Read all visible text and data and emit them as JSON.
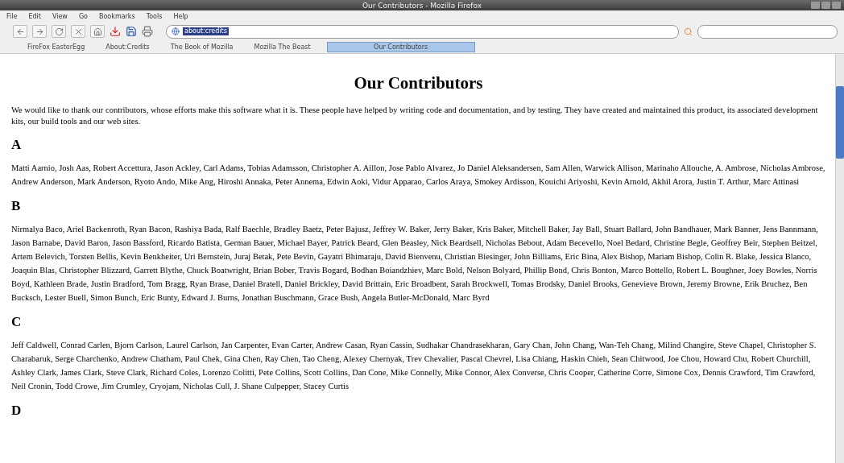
{
  "window": {
    "title": "Our Contributors - Mozilla Firefox"
  },
  "menu": [
    "File",
    "Edit",
    "View",
    "Go",
    "Bookmarks",
    "Tools",
    "Help"
  ],
  "address": {
    "value": "about:credits"
  },
  "bookmarks": [
    {
      "label": "FireFox EasterEgg",
      "selected": false
    },
    {
      "label": "About:Credits",
      "selected": false
    },
    {
      "label": "The Book of Mozilla",
      "selected": false
    },
    {
      "label": "Mozilla The Beast",
      "selected": false
    },
    {
      "label": "Our Contributors",
      "selected": true
    }
  ],
  "page": {
    "heading": "Our Contributors",
    "intro": "We would like to thank our contributors, whose efforts make this software what it is. These people have helped by writing code and documentation, and by testing. They have created and maintained this product, its associated development kits, our build tools and our web sites.",
    "sections": [
      {
        "letter": "A",
        "names": "Matti Aarnio, Josh Aas, Robert Accettura, Jason Ackley, Carl Adams, Tobias Adamsson, Christopher A. Aillon, Jose Pablo Alvarez, Jo Daniel Aleksandersen, Sam Allen, Warwick Allison, Marinaho Allouche, A. Ambrose, Nicholas Ambrose, Andrew Anderson, Mark Anderson, Ryoto Ando, Mike Ang, Hiroshi Annaka, Peter Annema, Edwin Aoki, Vidur Apparao, Carlos Araya, Smokey Ardisson, Kouichi Ariyoshi, Kevin Arnold, Akhil Arora, Justin T. Arthur, Marc Attinasi"
      },
      {
        "letter": "B",
        "names": "Nirmalya Baco, Ariel Backenroth, Ryan Bacon, Rashiya Bada, Ralf Baechle, Bradley Baetz, Peter Bajusz, Jeffrey W. Baker, Jerry Baker, Kris Baker, Mitchell Baker, Jay Ball, Stuart Ballard, John Bandhauer, Mark Banner, Jens Bannmann, Jason Barnabe, David Baron, Jason Bassford, Ricardo Batista, German Bauer, Michael Bayer, Patrick Beard, Glen Beasley, Nick Beardsell, Nicholas Bebout, Adam Becevello, Noel Bedard, Christine Begle, Geoffrey Beir, Stephen Beitzel, Artem Belevich, Torsten Bellis, Kevin Benkheiter, Uri Bernstein, Juraj Betak, Pete Bevin, Gayatri Bhimaraju, David Bienvenu, Christian Biesinger, John Billiams, Eric Bina, Alex Bishop, Mariam Bishop, Colin R. Blake, Jessica Blanco, Joaquin Blas, Christopher Blizzard, Garrett Blythe, Chuck Boatwright, Brian Bober, Travis Bogard, Bodhan Boiandzhiev, Marc Bold, Nelson Bolyard, Phillip Bond, Chris Bonton, Marco Bottello, Robert L. Boughner, Joey Bowles, Norris Boyd, Kathleen Brade, Justin Bradford, Tom Bragg, Ryan Brase, Daniel Bratell, Daniel Brickley, David Brittain, Eric Broadbent, Sarah Brockwell, Tomas Brodsky, Daniel Brooks, Genevieve Brown, Jeremy Browne, Erik Bruchez, Ben Bucksch, Lester Buell, Simon Bunch, Eric Bunty, Edward J. Burns, Jonathan Buschmann, Grace Bush, Angela Butler-McDonald, Marc Byrd"
      },
      {
        "letter": "C",
        "names": "Jeff Caldwell, Conrad Carlen, Bjorn Carlson, Laurel Carlson, Jan Carpenter, Evan Carter, Andrew Casan, Ryan Cassin, Sudhakar Chandrasekharan, Gary Chan, John Chang, Wan-Teh Chang, Milind Changire, Steve Chapel, Christopher S. Charabaruk, Serge Charchenko, Andrew Chatham, Paul Chek, Gina Chen, Ray Chen, Tao Cheng, Alexey Chernyak, Trev Chevalier, Pascal Chevrel, Lisa Chiang, Haskin Chieh, Sean Chitwood, Joe Chou, Howard Chu, Robert Churchill, Ashley Clark, James Clark, Steve Clark, Richard Coles, Lorenzo Colitti, Pete Collins, Scott Collins, Dan Cone, Mike Connelly, Mike Connor, Alex Converse, Chris Cooper, Catherine Corre, Simone Cox, Dennis Crawford, Tim Crawford, Neil Cronin, Todd Crowe, Jim Crumley, Cryojam, Nicholas Cull, J. Shane Culpepper, Stacey Curtis"
      },
      {
        "letter": "D"
      }
    ]
  }
}
